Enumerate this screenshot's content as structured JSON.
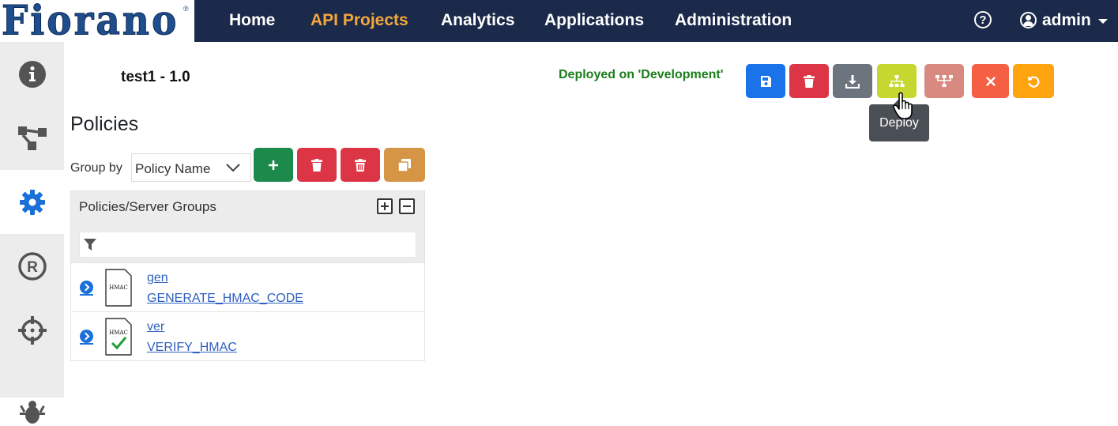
{
  "logo": {
    "text": "Fiorano",
    "reg": "®"
  },
  "nav": {
    "items": [
      {
        "label": "Home",
        "active": false
      },
      {
        "label": "API Projects",
        "active": true
      },
      {
        "label": "Analytics",
        "active": false
      },
      {
        "label": "Applications",
        "active": false
      },
      {
        "label": "Administration",
        "active": false
      }
    ],
    "help_glyph": "?",
    "user": "admin",
    "accent": "#f5a73b",
    "bar_color": "#1b2a4a"
  },
  "sidebar": {
    "items": [
      {
        "icon": "info-icon"
      },
      {
        "icon": "flow-icon"
      },
      {
        "icon": "gear-icon",
        "active": true
      },
      {
        "icon": "registered-icon"
      },
      {
        "icon": "crosshair-icon"
      },
      {
        "icon": "bug-icon"
      }
    ]
  },
  "project": {
    "title": "test1 - 1.0",
    "status": "Deployed on 'Development'"
  },
  "toolbar": {
    "buttons": [
      {
        "name": "save",
        "icon": "save-icon",
        "color": "#1a73e8"
      },
      {
        "name": "delete",
        "icon": "trash-icon",
        "color": "#dc3545"
      },
      {
        "name": "download",
        "icon": "download-icon",
        "color": "#6c757d"
      },
      {
        "name": "deploy",
        "icon": "sitemap-icon",
        "color": "#c6d82f"
      },
      {
        "name": "undeploy",
        "icon": "network-icon",
        "color": "#d88a80"
      },
      {
        "name": "close",
        "icon": "close-icon",
        "color": "#f55f44"
      },
      {
        "name": "revert",
        "icon": "undo-icon",
        "color": "#ffa30f"
      }
    ],
    "tooltip": "Deploy"
  },
  "policies": {
    "heading": "Policies",
    "group_by_label": "Group by",
    "group_by_value": "Policy Name",
    "panel_title": "Policies/Server Groups",
    "filter_placeholder": "",
    "rows": [
      {
        "name": "gen",
        "type": "GENERATE_HMAC_CODE",
        "badge": "HMAC"
      },
      {
        "name": "ver",
        "type": "VERIFY_HMAC",
        "badge": "HMAC"
      }
    ]
  }
}
